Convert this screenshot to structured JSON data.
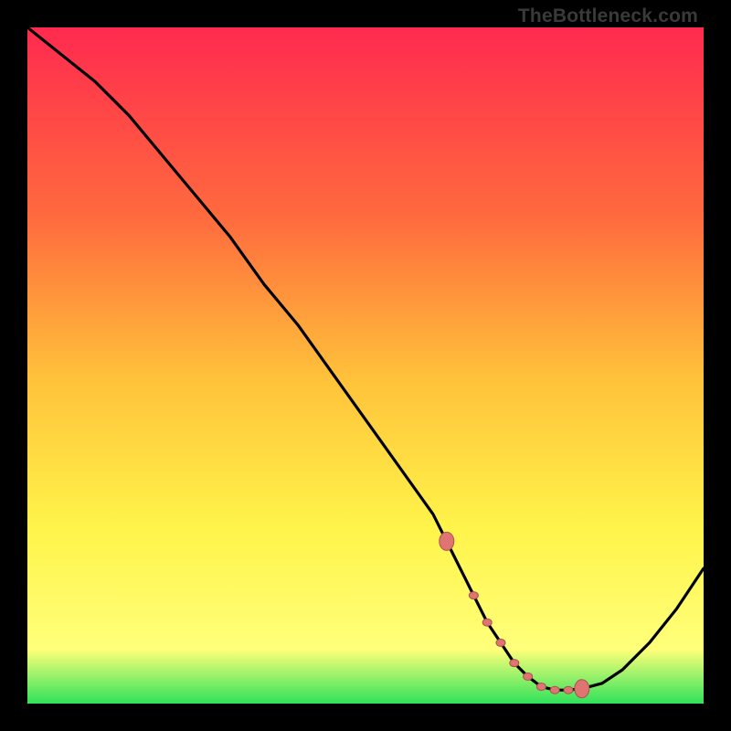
{
  "watermark": "TheBottleneck.com",
  "colors": {
    "gradient_top": "#ff2a4f",
    "gradient_mid_upper": "#ff6a3e",
    "gradient_mid": "#ffc23a",
    "gradient_mid_lower": "#fff44a",
    "gradient_lower": "#ffff7a",
    "gradient_bottom": "#2fe25a",
    "background": "#000000",
    "curve": "#000000",
    "marker_fill": "#e07472",
    "marker_stroke": "#a9534f"
  },
  "chart_data": {
    "type": "line",
    "title": "",
    "xlabel": "",
    "ylabel": "",
    "ylim": [
      0,
      100
    ],
    "x": [
      0,
      5,
      10,
      15,
      20,
      25,
      30,
      35,
      40,
      45,
      50,
      55,
      60,
      62,
      64,
      66,
      68,
      70,
      72,
      74,
      76,
      78,
      80,
      82,
      85,
      88,
      92,
      96,
      100
    ],
    "values": [
      100,
      96,
      92,
      87,
      81,
      75,
      69,
      62,
      56,
      49,
      42,
      35,
      28,
      24,
      20,
      16,
      12,
      9,
      6,
      4,
      2.5,
      2,
      2,
      2.2,
      3,
      5,
      9,
      14,
      20
    ],
    "markers_x": [
      62,
      66,
      68,
      70,
      72,
      74,
      76,
      78,
      80,
      82
    ],
    "markers_y": [
      24,
      16,
      12,
      9,
      6,
      4,
      2.5,
      2,
      2,
      2.2
    ]
  }
}
